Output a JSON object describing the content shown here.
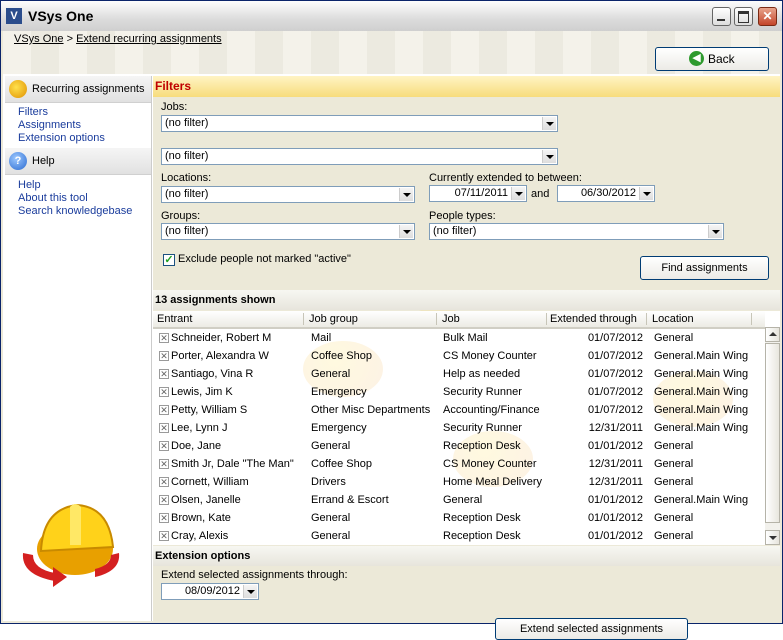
{
  "window": {
    "title": "VSys One",
    "app_icon": "V"
  },
  "breadcrumb": {
    "home": "VSys One",
    "separator": ">",
    "current": "Extend recurring assignments"
  },
  "back_button": {
    "label": "Back"
  },
  "sidebar": {
    "section1_title": "Recurring assignments",
    "section1_links": [
      "Filters",
      "Assignments",
      "Extension options"
    ],
    "section2_title": "Help",
    "section2_links": [
      "Help",
      "About this tool",
      "Search knowledgebase"
    ]
  },
  "filters": {
    "title": "Filters",
    "jobs_label": "Jobs:",
    "jobs_value": "(no filter)",
    "locations_label": "Locations:",
    "locations_value": "(no filter)",
    "extended_label": "Currently extended to between:",
    "date_from": "07/11/2011",
    "and_label": "and",
    "date_to": "06/30/2012",
    "groups_label": "Groups:",
    "groups_value": "(no filter)",
    "people_types_label": "People types:",
    "people_types_value": "(no filter)",
    "exclude_label": "Exclude people not marked \"active\"",
    "exclude_checked": true,
    "find_button": "Find assignments"
  },
  "assignments": {
    "count_label": "13 assignments shown",
    "columns": [
      "Entrant",
      "Job group",
      "Job",
      "Extended through",
      "Location"
    ],
    "rows": [
      [
        "Schneider, Robert M",
        "Mail",
        "Bulk Mail",
        "01/07/2012",
        "General"
      ],
      [
        "Porter, Alexandra W",
        "Coffee Shop",
        "CS Money Counter",
        "01/07/2012",
        "General.Main Wing"
      ],
      [
        "Santiago, Vina R",
        "General",
        "Help as needed",
        "01/07/2012",
        "General.Main Wing"
      ],
      [
        "Lewis, Jim K",
        "Emergency",
        "Security Runner",
        "01/07/2012",
        "General.Main Wing"
      ],
      [
        "Petty, William S",
        "Other Misc Departments",
        "Accounting/Finance",
        "01/07/2012",
        "General.Main Wing"
      ],
      [
        "Lee, Lynn J",
        "Emergency",
        "Security Runner",
        "12/31/2011",
        "General.Main Wing"
      ],
      [
        "Doe, Jane",
        "General",
        "Reception Desk",
        "01/01/2012",
        "General"
      ],
      [
        "Smith Jr, Dale \"The Man\"",
        "Coffee Shop",
        "CS Money Counter",
        "12/31/2011",
        "General"
      ],
      [
        "Cornett, William",
        "Drivers",
        "Home Meal Delivery",
        "12/31/2011",
        "General"
      ],
      [
        "Olsen, Janelle",
        "Errand & Escort",
        "General",
        "01/01/2012",
        "General.Main Wing"
      ],
      [
        "Brown, Kate",
        "General",
        "Reception Desk",
        "01/01/2012",
        "General"
      ],
      [
        "Cray, Alexis",
        "General",
        "Reception Desk",
        "01/01/2012",
        "General"
      ]
    ]
  },
  "extension": {
    "title": "Extension options",
    "through_label": "Extend selected assignments through:",
    "through_value": "08/09/2012",
    "extend_button": "Extend selected assignments"
  },
  "icons": {
    "app": "vsys-app-icon",
    "back": "green-back-arrow-icon",
    "section1": "hard-hat-icon",
    "section2": "help-icon",
    "row_checkbox": "x-box-icon",
    "big_logo": "hard-hat-refresh-icon"
  }
}
